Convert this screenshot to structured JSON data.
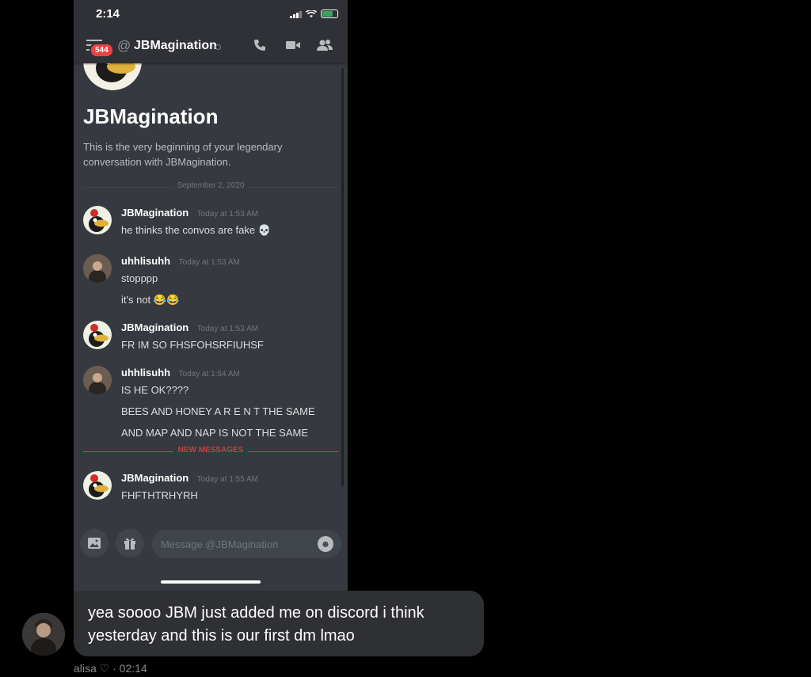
{
  "status_bar": {
    "time": "2:14"
  },
  "header": {
    "badge": "544",
    "at": "@",
    "title": "JBMagination"
  },
  "intro": {
    "title": "JBMagination",
    "text": "This is the very beginning of your legendary conversation with JBMagination."
  },
  "date_divider": "September 2, 2020",
  "new_divider": "NEW MESSAGES",
  "messages": [
    {
      "author": "JBMagination",
      "time": "Today at 1:53 AM",
      "lines": [
        "he thinks the convos are fake 💀"
      ]
    },
    {
      "author": "uhhlisuhh",
      "time": "Today at 1:53 AM",
      "lines": [
        "stopppp",
        "it's not 😂😂"
      ]
    },
    {
      "author": "JBMagination",
      "time": "Today at 1:53 AM",
      "lines": [
        "FR IM SO FHSFOHSRFIUHSF"
      ]
    },
    {
      "author": "uhhlisuhh",
      "time": "Today at 1:54 AM",
      "lines": [
        "IS HE OK????",
        "BEES AND HONEY A R E N T THE SAME",
        "AND MAP AND NAP IS NOT THE SAME"
      ]
    },
    {
      "author": "JBMagination",
      "time": "Today at 1:55 AM",
      "lines": [
        "FHFTHTRHYRH"
      ]
    }
  ],
  "composer": {
    "placeholder": "Message @JBMagination"
  },
  "reply": {
    "text": "yea soooo JBM just added me on discord i think yesterday and this is our first dm lmao",
    "meta": "alisa ♡ · 02:14"
  },
  "icons": {
    "menu": "hamburger-icon",
    "call": "phone-call-icon",
    "video": "video-camera-icon",
    "members": "members-icon",
    "image": "image-icon",
    "gift": "gift-icon",
    "emoji": "emoji-icon"
  },
  "colors": {
    "background": "#36393f",
    "header": "#2f3136",
    "badge": "#ed4245",
    "new_messages": "#ed4245"
  }
}
